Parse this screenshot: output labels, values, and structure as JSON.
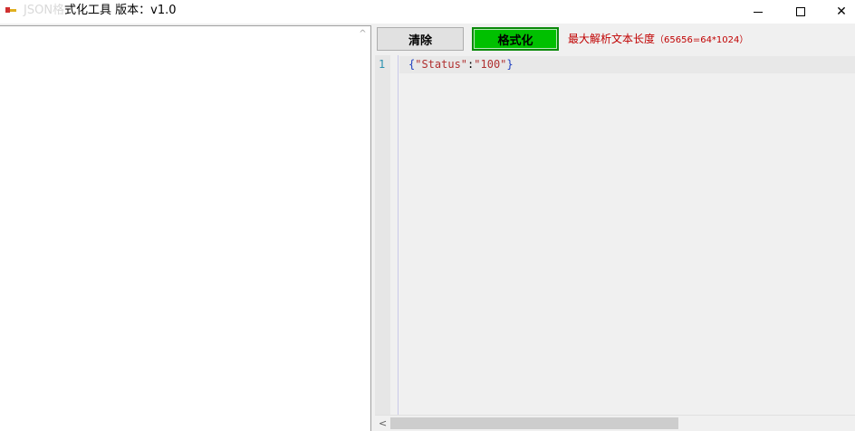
{
  "window": {
    "title_faded": "JSON格",
    "title": "式化工具  版本：v1.0",
    "minimize_icon": "minimize-icon",
    "maximize_icon": "maximize-icon",
    "close_icon": "close-icon",
    "close_glyph": "✕"
  },
  "left_pane": {
    "value": "",
    "scroll_up_glyph": "^"
  },
  "toolbar": {
    "clear_label": "清除",
    "format_label": "格式化",
    "format_color": "#00c000",
    "limit_text": "最大解析文本长度",
    "limit_detail": "（65656=64*1024）",
    "limit_color": "#c00000"
  },
  "editor": {
    "line_number": "1",
    "code": {
      "open_brace": "{",
      "key": "\"Status\"",
      "colon": ":",
      "value": "\"100\"",
      "close_brace": "}"
    }
  },
  "hscroll": {
    "left_arrow_glyph": "<"
  }
}
